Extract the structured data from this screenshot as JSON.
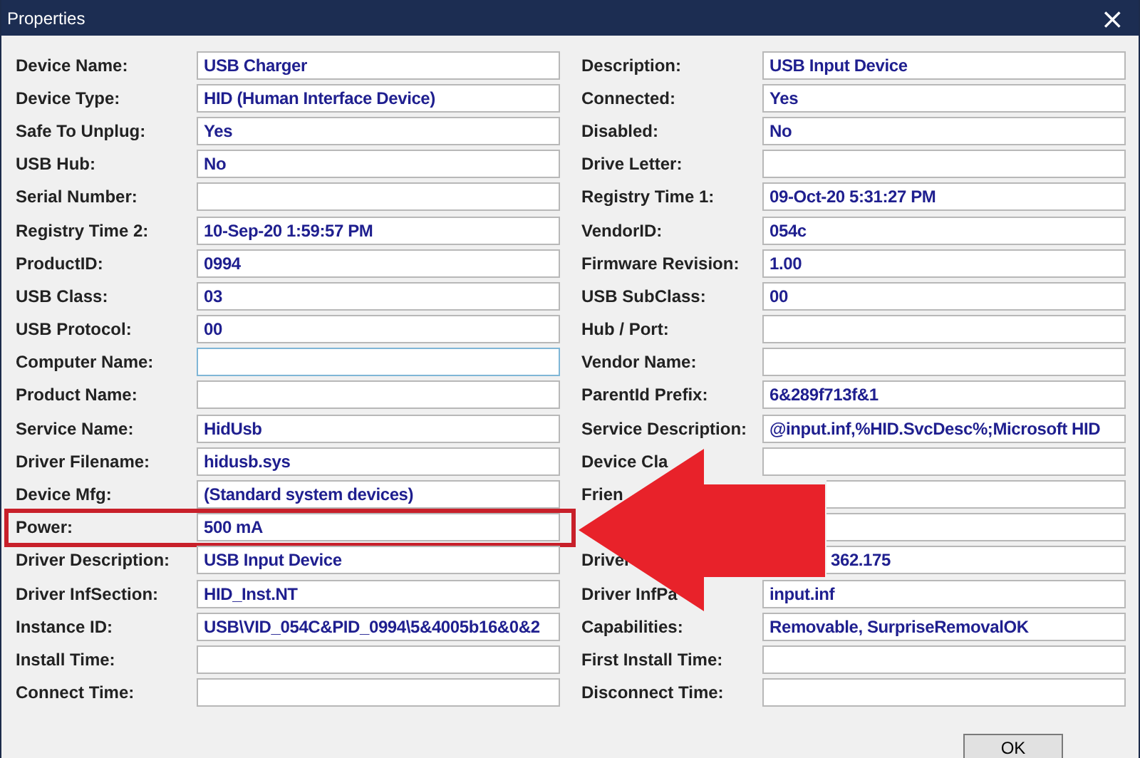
{
  "window": {
    "title": "Properties",
    "close": "×"
  },
  "left_fields": [
    {
      "label": "Device Name:",
      "value": "USB Charger",
      "focused": false,
      "highlighted": false
    },
    {
      "label": "Device Type:",
      "value": "HID (Human Interface Device)",
      "focused": false,
      "highlighted": false
    },
    {
      "label": "Safe To Unplug:",
      "value": "Yes",
      "focused": false,
      "highlighted": false
    },
    {
      "label": "USB Hub:",
      "value": "No",
      "focused": false,
      "highlighted": false
    },
    {
      "label": "Serial Number:",
      "focused": false,
      "highlighted": false
    },
    {
      "label": "Registry Time 2:",
      "value": "10-Sep-20 1:59:57 PM",
      "focused": false,
      "highlighted": false
    },
    {
      "label": "ProductID:",
      "value": "0994",
      "focused": false,
      "highlighted": false
    },
    {
      "label": "USB Class:",
      "value": "03",
      "focused": false,
      "highlighted": false
    },
    {
      "label": "USB Protocol:",
      "value": "00",
      "focused": false,
      "highlighted": false
    },
    {
      "label": "Computer Name:",
      "focused": true,
      "highlighted": false
    },
    {
      "label": "Product Name:",
      "focused": false,
      "highlighted": false
    },
    {
      "label": "Service Name:",
      "value": "HidUsb",
      "focused": false,
      "highlighted": false
    },
    {
      "label": "Driver Filename:",
      "value": "hidusb.sys",
      "focused": false,
      "highlighted": false
    },
    {
      "label": "Device Mfg:",
      "value": "(Standard system devices)",
      "focused": false,
      "highlighted": false
    },
    {
      "label": "Power:",
      "value": "500 mA",
      "focused": false,
      "highlighted": true
    },
    {
      "label": "Driver Description:",
      "value": "USB Input Device",
      "focused": false,
      "highlighted": false
    },
    {
      "label": "Driver InfSection:",
      "value": "HID_Inst.NT",
      "focused": false,
      "highlighted": false
    },
    {
      "label": "Instance ID:",
      "value": "USB\\VID_054C&PID_0994\\5&4005b16&0&2",
      "focused": false,
      "highlighted": false
    },
    {
      "label": "Install Time:",
      "focused": false,
      "highlighted": false
    },
    {
      "label": "Connect Time:",
      "focused": false,
      "highlighted": false
    }
  ],
  "right_fields": [
    {
      "label": "Description:",
      "value": "USB Input Device",
      "focused": false,
      "highlighted": false
    },
    {
      "label": "Connected:",
      "value": "Yes",
      "focused": false,
      "highlighted": false
    },
    {
      "label": "Disabled:",
      "value": "No",
      "focused": false,
      "highlighted": false
    },
    {
      "label": "Drive Letter:",
      "focused": false,
      "highlighted": false
    },
    {
      "label": "Registry Time 1:",
      "value": "09-Oct-20 5:31:27 PM",
      "focused": false,
      "highlighted": false
    },
    {
      "label": "VendorID:",
      "value": "054c",
      "focused": false,
      "highlighted": false
    },
    {
      "label": "Firmware Revision:",
      "value": "1.00",
      "focused": false,
      "highlighted": false
    },
    {
      "label": "USB SubClass:",
      "value": "00",
      "focused": false,
      "highlighted": false
    },
    {
      "label": "Hub / Port:",
      "focused": false,
      "highlighted": false
    },
    {
      "label": "Vendor Name:",
      "focused": false,
      "highlighted": false
    },
    {
      "label": "ParentId Prefix:",
      "value": "6&289f713f&1",
      "focused": false,
      "highlighted": false
    },
    {
      "label": "Service Description:",
      "value": "@input.inf,%HID.SvcDesc%;Microsoft HID",
      "focused": false,
      "highlighted": false
    },
    {
      "label": "Device Cla",
      "focused": false,
      "highlighted": false
    },
    {
      "label": "Frien",
      "focused": false,
      "highlighted": false,
      "partly_hidden": true
    },
    {
      "focused": false,
      "highlighted": false,
      "partly_hidden": true
    },
    {
      "label": "Driver",
      "value": "362.175",
      "focused": false,
      "highlighted": false,
      "partly_hidden": true
    },
    {
      "label": "Driver InfPa",
      "value": "input.inf",
      "focused": false,
      "highlighted": false
    },
    {
      "label": "Capabilities:",
      "value": "Removable, SurpriseRemovalOK",
      "focused": false,
      "highlighted": false
    },
    {
      "label": "First Install Time:",
      "focused": false,
      "highlighted": false
    },
    {
      "label": "Disconnect Time:",
      "focused": false,
      "highlighted": false
    }
  ],
  "buttons": [
    {
      "label": "OK"
    }
  ]
}
